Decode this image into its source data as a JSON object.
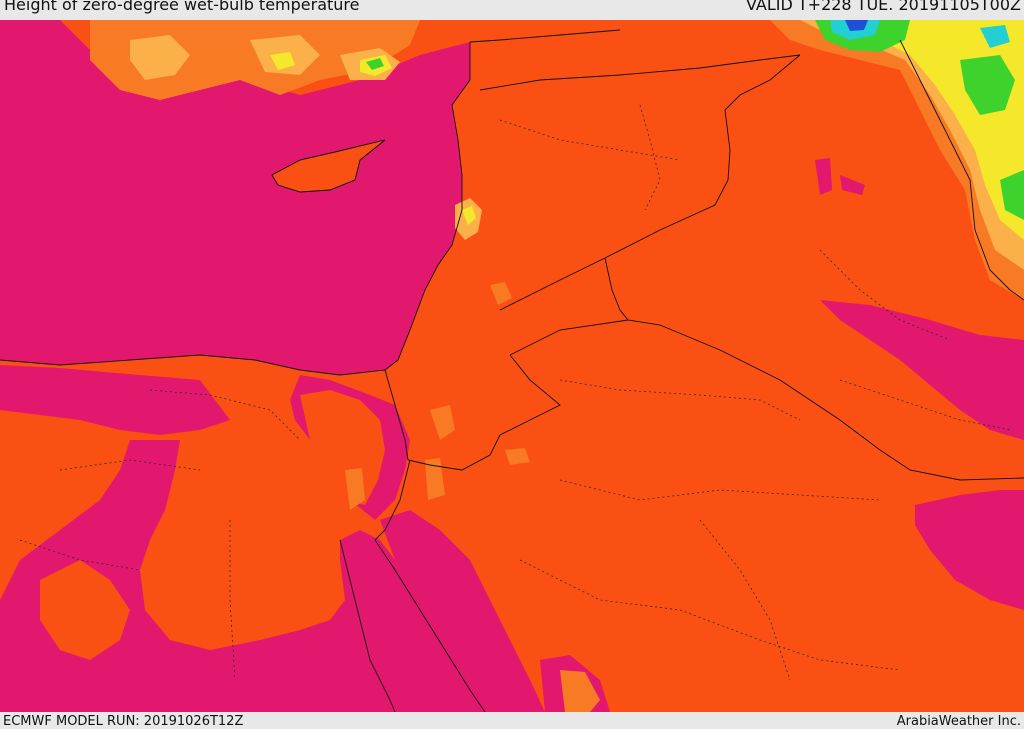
{
  "header": {
    "title": "Height of zero-degree wet-bulb temperature",
    "valid": "VALID T+228 TUE. 20191105T00Z"
  },
  "footer": {
    "model_run": "ECMWF MODEL RUN: 20191026T12Z",
    "credit": "ArabiaWeather Inc."
  },
  "map": {
    "region": "Eastern Mediterranean and Middle East",
    "colors": {
      "high_magenta": "#e2186e",
      "orange_red": "#fa5014",
      "orange": "#f87a24",
      "light_orange": "#fbb04a",
      "yellow": "#f5e82a",
      "green": "#3ed22c",
      "cyan": "#22cfd2",
      "blue": "#1e50d6",
      "border_line": "#111111"
    }
  }
}
